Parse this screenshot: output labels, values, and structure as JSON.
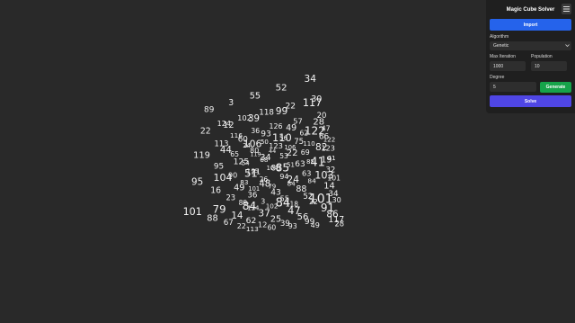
{
  "panel": {
    "title": "Magic Cube Solver",
    "menu_icon": "hamburger-icon",
    "import_label": "Import",
    "algorithm_label": "Algorithm",
    "algorithm_value": "Genetic",
    "max_iteration_label": "Max Iteration",
    "max_iteration_value": "1000",
    "population_label": "Population",
    "population_value": "10",
    "degree_label": "Degree",
    "degree_value": "5",
    "generate_label": "Generate",
    "solve_label": "Solve",
    "colors": {
      "import": "#2563eb",
      "generate": "#16a34a",
      "solve": "#4f46e5",
      "background": "#292929"
    }
  },
  "cube": {
    "degree": 5,
    "numbers": [
      "89",
      "3",
      "55",
      "52",
      "34",
      "22",
      "12",
      "39",
      "99",
      "117",
      "119",
      "44",
      "106",
      "110",
      "122",
      "95",
      "104",
      "51",
      "85",
      "41",
      "101",
      "79",
      "84",
      "84",
      "101",
      "124",
      "102",
      "118",
      "22",
      "30",
      "113",
      "60",
      "93",
      "49",
      "28",
      "95",
      "125",
      "34",
      "22",
      "82",
      "16",
      "49",
      "48",
      "24",
      "103",
      "88",
      "14",
      "37",
      "47",
      "91",
      "116",
      "36",
      "126",
      "57",
      "20",
      "65",
      "80",
      "123",
      "75",
      "66",
      "90",
      "121",
      "88",
      "63",
      "19",
      "23",
      "36",
      "43",
      "88",
      "14",
      "67",
      "62",
      "25",
      "56",
      "86",
      "24",
      "50",
      "56",
      "62",
      "47",
      "54",
      "68",
      "53",
      "69",
      "123",
      "83",
      "26",
      "94",
      "63",
      "32"
    ]
  }
}
